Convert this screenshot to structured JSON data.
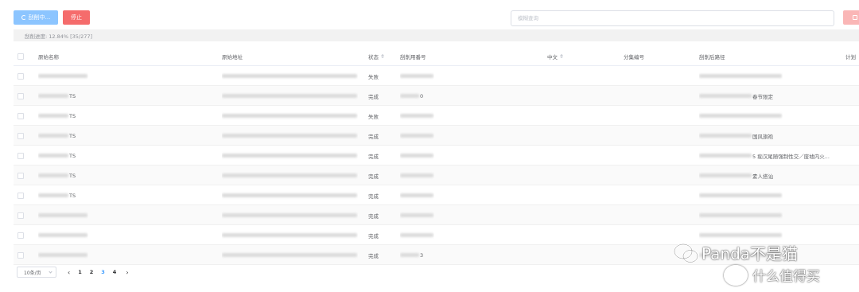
{
  "toolbar": {
    "scrape_label": "刮削中...",
    "stop_label": "停止",
    "search_placeholder": "模糊查询"
  },
  "progress": {
    "text": "刮削进度: 12.84% [35/277]"
  },
  "table": {
    "headers": {
      "name": "原始名称",
      "url": "原始地址",
      "status": "状态",
      "code": "刮削用番号",
      "chinese": "中文",
      "episode": "分集编号",
      "path": "刮削后路径",
      "plan": "计划"
    },
    "rows": [
      {
        "name": "",
        "url": "",
        "status": "失败",
        "code": "",
        "path": ""
      },
      {
        "name": "TS",
        "url": "",
        "status": "完成",
        "code": "0",
        "path": "春节限定"
      },
      {
        "name": "TS",
        "url": "",
        "status": "失败",
        "code": "",
        "path": ""
      },
      {
        "name": "TS",
        "url": "",
        "status": "完成",
        "code": "",
        "path": "国风旗袍"
      },
      {
        "name": "TS",
        "url": "",
        "status": "完成",
        "code": "",
        "path": "5 痴汉尾随强制性交／废墟内火..."
      },
      {
        "name": "TS",
        "url": "",
        "status": "完成",
        "code": "",
        "path": "素人搭讪"
      },
      {
        "name": "TS",
        "url": "",
        "status": "完成",
        "code": "",
        "path": ""
      },
      {
        "name": "",
        "url": "",
        "status": "完成",
        "code": "",
        "path": ""
      },
      {
        "name": "",
        "url": "",
        "status": "完成",
        "code": "",
        "path": ""
      },
      {
        "name": "",
        "url": "",
        "status": "完成",
        "code": "3",
        "path": ""
      }
    ]
  },
  "pagination": {
    "page_size": "10条/页",
    "prev": "‹",
    "next": "›",
    "pages": [
      "1",
      "2",
      "3",
      "4"
    ],
    "current": "3"
  },
  "watermark": {
    "line1": "Panda不是猫",
    "line2": "什么值得买"
  },
  "colors": {
    "primary_light": "#8cc5ff",
    "danger": "#f56c6c",
    "danger_light": "#fab6b6",
    "active_page": "#409eff"
  }
}
